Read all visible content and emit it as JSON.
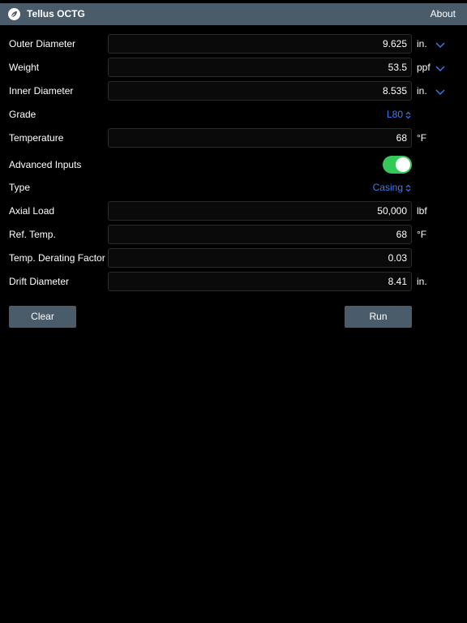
{
  "header": {
    "app_title": "Tellus OCTG",
    "about_label": "About"
  },
  "fields": {
    "outer_diameter": {
      "label": "Outer Diameter",
      "value": "9.625",
      "unit": "in."
    },
    "weight": {
      "label": "Weight",
      "value": "53.5",
      "unit": "ppf"
    },
    "inner_diameter": {
      "label": "Inner Diameter",
      "value": "8.535",
      "unit": "in."
    },
    "grade": {
      "label": "Grade",
      "value": "L80"
    },
    "temperature": {
      "label": "Temperature",
      "value": "68",
      "unit": "°F"
    },
    "advanced_inputs": {
      "label": "Advanced Inputs",
      "enabled": true
    },
    "type": {
      "label": "Type",
      "value": "Casing"
    },
    "axial_load": {
      "label": "Axial Load",
      "value": "50,000",
      "unit": "lbf"
    },
    "ref_temp": {
      "label": "Ref. Temp.",
      "value": "68",
      "unit": "°F"
    },
    "temp_derating_factor": {
      "label": "Temp. Derating Factor",
      "value": "0.03"
    },
    "drift_diameter": {
      "label": "Drift Diameter",
      "value": "8.41",
      "unit": "in."
    }
  },
  "actions": {
    "clear_label": "Clear",
    "run_label": "Run"
  },
  "colors": {
    "navbar": "#4a5b6a",
    "accent": "#3d7bf2",
    "toggle_on": "#34c759",
    "background": "#000000"
  },
  "icons": {
    "app": "leaf-icon",
    "unit_dropdown": "chevron-down-icon",
    "picker": "up-down-chevron-icon"
  }
}
